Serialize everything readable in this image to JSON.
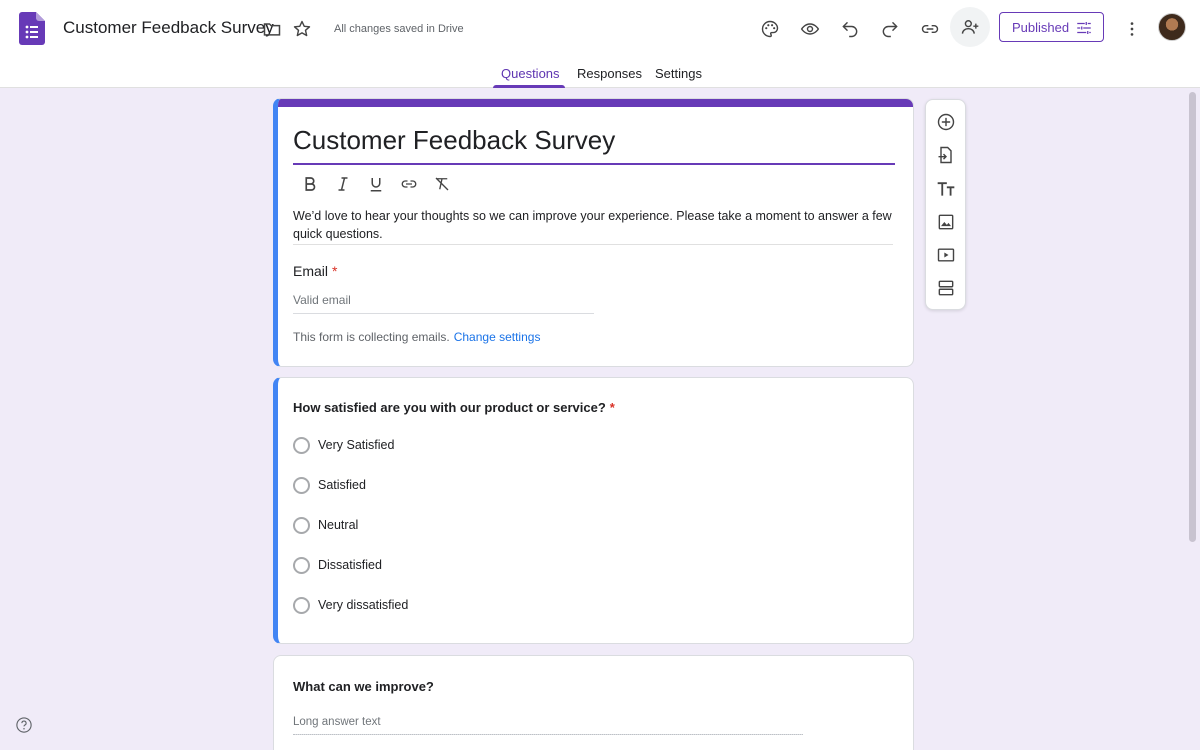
{
  "topbar": {
    "doc_title": "Customer Feedback Survey",
    "save_status": "All changes saved in Drive",
    "publish_label": "Published",
    "icons": [
      "palette-icon",
      "eye-icon",
      "undo-icon",
      "redo-icon",
      "link-icon",
      "add-person-icon",
      "more-vert-icon"
    ]
  },
  "tabs": [
    {
      "label": "Questions",
      "active": true
    },
    {
      "label": "Responses",
      "active": false
    },
    {
      "label": "Settings",
      "active": false
    }
  ],
  "form": {
    "title": "Customer Feedback Survey",
    "description": "We’d love to hear your thoughts so we can improve your experience. Please take a moment to answer a few quick questions.",
    "email_label": "Email",
    "required_mark": "*",
    "email_placeholder": "Valid email",
    "collect_note": "This form is collecting emails.",
    "change_settings": "Change settings"
  },
  "questions": [
    {
      "title": "How satisfied are you with our product or service?",
      "required": "*",
      "options": [
        "Very Satisfied",
        "Satisfied",
        "Neutral",
        "Dissatisfied",
        "Very dissatisfied"
      ]
    },
    {
      "title": "What can we improve?",
      "placeholder": "Long answer text"
    }
  ],
  "colors": {
    "accent": "#673ab7",
    "background": "#f0ebf8",
    "selection": "#4285f4",
    "link": "#1a73e8",
    "required": "#d93025"
  }
}
